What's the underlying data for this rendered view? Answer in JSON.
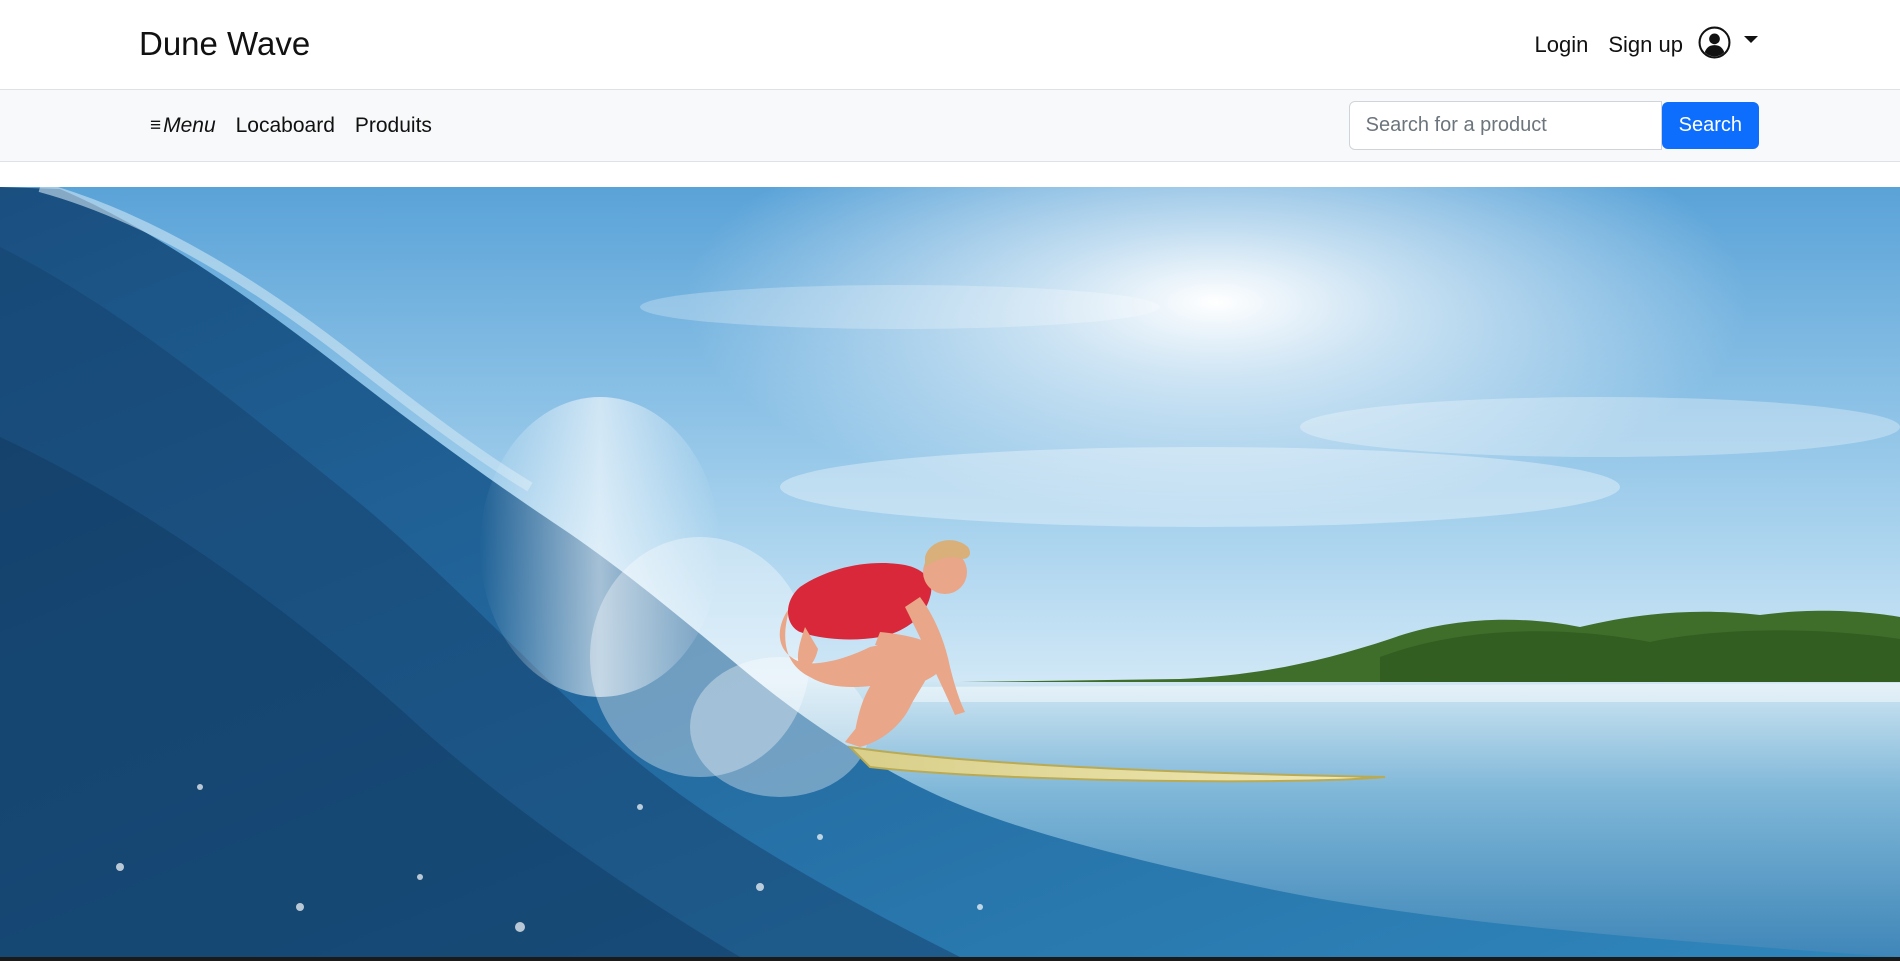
{
  "header": {
    "brand": "Dune Wave",
    "auth": {
      "login": "Login",
      "signup": "Sign up"
    },
    "user_icon": "user-circle-icon"
  },
  "nav": {
    "menu_glyph": "≡",
    "menu_label": "Menu",
    "links": [
      "Locaboard",
      "Produits"
    ]
  },
  "search": {
    "placeholder": "Search for a product",
    "value": "",
    "button": "Search"
  },
  "hero": {
    "image_alt": "Surfer in a red swimsuit riding a large blue wave",
    "colors": {
      "sky": "#8cc4e8",
      "wave": "#1f5f93",
      "swimsuit": "#d8283a",
      "board": "#e8dc9a",
      "island": "#3f6e2a"
    }
  },
  "colors": {
    "primary": "#0d6efd",
    "nav_bg": "#f8f9fa",
    "border": "#dee2e6"
  }
}
